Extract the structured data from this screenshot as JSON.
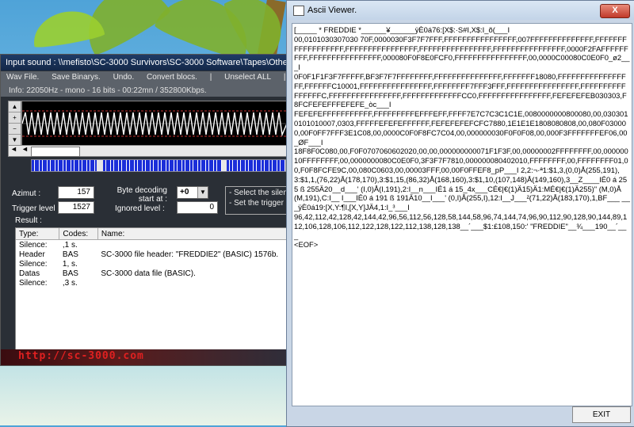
{
  "input_window": {
    "title": "Input sound : \\\\mefisto\\SC-3000 Survivors\\SC-3000 Software\\Tapes\\Other",
    "menu": [
      "Wav File.",
      "Save Binarys.",
      "Undo.",
      "Convert blocs.",
      "|",
      "Unselect ALL",
      "|"
    ],
    "info": "Info: 22050Hz - mono - 16 bits - 00:22mn / 352800Kbps.",
    "azimut_label": "Azimut :",
    "azimut_value": "157",
    "trigger_label": "Trigger level :",
    "trigger_value": "1527",
    "byte_decoding_label": "Byte decoding start at :",
    "byte_decoding_value": "+0",
    "ignored_label": "Ignored level :",
    "ignored_value": "0",
    "hint_lines": [
      "- Select the silence",
      "- Set the trigger le"
    ],
    "result_label": "Result :",
    "columns": [
      "Type:",
      "Codes:",
      "Name:"
    ],
    "rows": [
      {
        "type": "Silence:",
        "code": ",1 s.",
        "name": ""
      },
      {
        "type": "Header",
        "code": "BAS",
        "name": "SC-3000 file header: \"FREDDIE2\" (BASIC) 1576b."
      },
      {
        "type": "Silence:",
        "code": "1, s.",
        "name": ""
      },
      {
        "type": "Datas",
        "code": "BAS",
        "name": "SC-3000 data file (BASIC)."
      },
      {
        "type": "Silence:",
        "code": ",3 s.",
        "name": ""
      }
    ],
    "footer_url": "http://sc-3000.com"
  },
  "ascii_window": {
    "title": "Ascii Viewer.",
    "close_label": "X",
    "text": "[_____ * FREDDIE *______¥______ÿÈ0á76:[X$:·S#I,X$:I_õ(___I\n00,0101030307030 70F,0000030F3F7F7FFF,FFFFFFFFFFFFFFFF,007FFFFFFFFFFFFFF,FFFFFFFFFFFFFFFFFF,FFFFFFFFFFFFFFFF,FFFFFFFFFFFFFFFF,FFFFFFFFFFFFFFFF,0000F2FAFFFFFFFFF,FFFFFFFFFFFFFFFF,000080F0F8E0FCF0,FFFFFFFFFFFFFFFF,00,0000C00080C0E0F0_ø2___I\n0F0F1F1F3F7FFFFF,BF3F7F7FFFFFFFF,FFFFFFFFFFFFFFF,FFFFFFF18080,FFFFFFFFFFFFFFFFF,FFFFFFC10001,FFFFFFFFFFFFFFFF,FFFFFFFF7FFF3FFF,FFFFFFFFFFFFFFFF,FFFFFFFFFFFFFFFFC,FFFFFFFFFFFFFFFF,FFFFFFFFFFFFFCC0,FFFFFFFFFFFFFFFF,FEFEFEFEB030303,F8FCFEFEFFFEFEFE_òc___I\nFEFEFEFFFFFFFFFFF,FFFFFFFFFEFFFEFF,FFFF7E7C7C3C1C1E,0080000000800080,00,0303010101010007,0303,FFFFFEFEFEFFFFFF,FEFEFEFEFCFC7880,1E1E1E1808080808,00,080F030000,00F0FF7FFF3E1C08,00,0000C0F0F8FC7C04,00,000000030F0F0F08,00,000F3FFFFFFFEF06,00_ØF___I\n18F8F0C080,00,F0F0707060602020,00,00,000000000071F1F3F,00,00000002FFFFFFFF,00,00000010FFFFFFFF,00,0000000080C0E0F0,3F3F7F7810,000000080402010,FFFFFFFF,00,FFFFFFFF01,00,F0F8FCFE9C,00,080C0603,00,00003FFF,00,00F0FFEF8_pP___I 2,2:¬·ª1:$1,3,(0,0)Å(255,191),3:$1,1,(76,22)Å(178,170),3:$1,15,(86,32)Å(168,160),3:$1,10,(107,148)Å(149,160),3__Z____IÉ0 á 255 ß 255Ä20__d___' (I,0)Å(I,191),2:I__n___IÉ1 á 15_4x___CÉ€|€(1)Ä15)Ä1:MÉ€|€(1)Ä255)\" (M,0)Å(M,191),C:I__ I___IÉ0 á 191 ß 191Ä10__I___' (0,I)Å(255,I),12:I__J___²(71,22)Å(183,170),1,BF___ ___ÿÈ0á19:[X,Y:¶I,[X,Y]JÄ4,1:I_³___I\n96,42,112,42,128,42,144,42,96,56,112,56,128,58,144,58,96,74,144,74,96,90,112,90,128,90,144,89,112,106,128,106,112,122,128,122,112,138,128,138__´___$1:£108,150:' \"FREDDIE\"__¾___190__´___\n<EOF>",
    "exit_label": "EXIT"
  }
}
